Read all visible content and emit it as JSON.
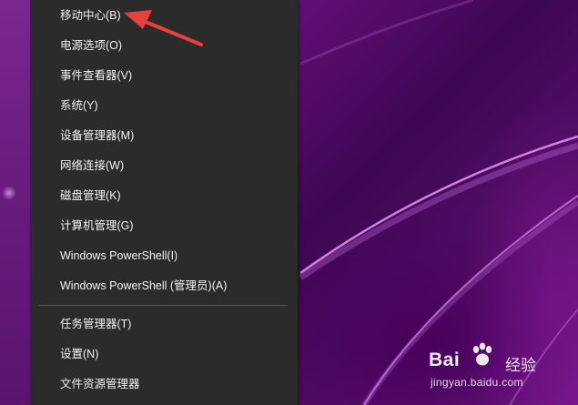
{
  "menu": {
    "items": [
      {
        "label": "移动中心(B)"
      },
      {
        "label": "电源选项(O)"
      },
      {
        "label": "事件查看器(V)"
      },
      {
        "label": "系统(Y)"
      },
      {
        "label": "设备管理器(M)"
      },
      {
        "label": "网络连接(W)"
      },
      {
        "label": "磁盘管理(K)"
      },
      {
        "label": "计算机管理(G)"
      },
      {
        "label": "Windows PowerShell(I)"
      },
      {
        "label": "Windows PowerShell (管理员)(A)"
      }
    ],
    "items_after_separator": [
      {
        "label": "任务管理器(T)"
      },
      {
        "label": "设置(N)"
      },
      {
        "label": "文件资源管理器"
      }
    ]
  },
  "annotation": {
    "arrow_color": "#e8413c"
  },
  "watermark": {
    "brand_prefix": "Bai",
    "brand_suffix": "经验",
    "url": "jingyan.baidu.com"
  },
  "colors": {
    "menu_background": "#2b2b2b",
    "menu_text": "#f2f2f2",
    "separator": "#555555",
    "wallpaper": "#5d0e70"
  }
}
